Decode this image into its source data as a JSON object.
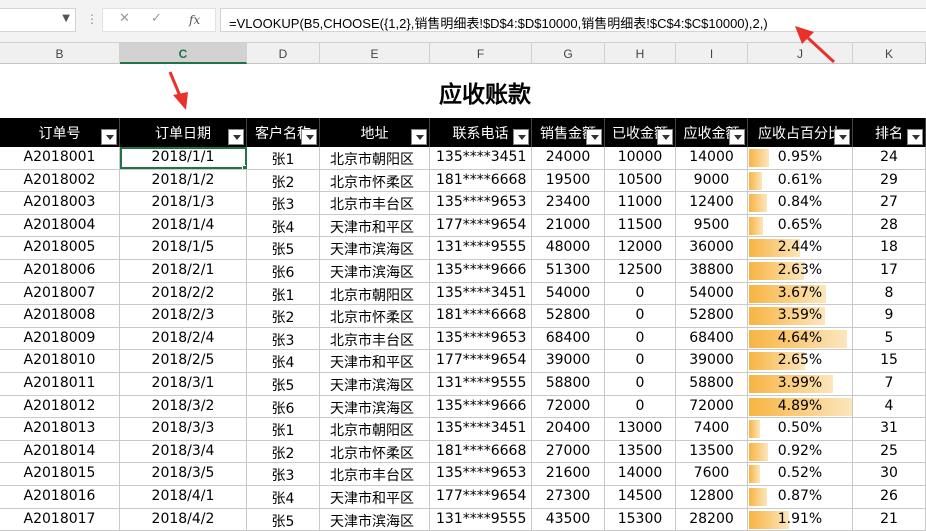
{
  "formula_bar": {
    "cancel_icon": "✕",
    "enter_icon": "✓",
    "fx_label": "fx",
    "formula": "=VLOOKUP(B5,CHOOSE({1,2},销售明细表!$D$4:$D$10000,销售明细表!$C$4:$C$10000),2,)"
  },
  "columns": [
    "B",
    "C",
    "D",
    "E",
    "F",
    "G",
    "H",
    "I",
    "J",
    "K"
  ],
  "selected_column": "C",
  "title": "应收账款",
  "headers": [
    "订单号",
    "订单日期",
    "客户名称",
    "地址",
    "联系电话",
    "销售金额",
    "已收金额",
    "应收金额",
    "应收占百分比",
    "排名"
  ],
  "rows": [
    [
      "A2018001",
      "2018/1/1",
      "张1",
      "北京市朝阳区",
      "135****3451",
      "24000",
      "10000",
      "14000",
      "0.95%",
      "24"
    ],
    [
      "A2018002",
      "2018/1/2",
      "张2",
      "北京市怀柔区",
      "181****6668",
      "19500",
      "10500",
      "9000",
      "0.61%",
      "29"
    ],
    [
      "A2018003",
      "2018/1/3",
      "张3",
      "北京市丰台区",
      "135****9653",
      "23400",
      "11000",
      "12400",
      "0.84%",
      "27"
    ],
    [
      "A2018004",
      "2018/1/4",
      "张4",
      "天津市和平区",
      "177****9654",
      "21000",
      "11500",
      "9500",
      "0.65%",
      "28"
    ],
    [
      "A2018005",
      "2018/1/5",
      "张5",
      "天津市滨海区",
      "131****9555",
      "48000",
      "12000",
      "36000",
      "2.44%",
      "18"
    ],
    [
      "A2018006",
      "2018/2/1",
      "张6",
      "天津市滨海区",
      "135****9666",
      "51300",
      "12500",
      "38800",
      "2.63%",
      "17"
    ],
    [
      "A2018007",
      "2018/2/2",
      "张1",
      "北京市朝阳区",
      "135****3451",
      "54000",
      "0",
      "54000",
      "3.67%",
      "8"
    ],
    [
      "A2018008",
      "2018/2/3",
      "张2",
      "北京市怀柔区",
      "181****6668",
      "52800",
      "0",
      "52800",
      "3.59%",
      "9"
    ],
    [
      "A2018009",
      "2018/2/4",
      "张3",
      "北京市丰台区",
      "135****9653",
      "68400",
      "0",
      "68400",
      "4.64%",
      "5"
    ],
    [
      "A2018010",
      "2018/2/5",
      "张4",
      "天津市和平区",
      "177****9654",
      "39000",
      "0",
      "39000",
      "2.65%",
      "15"
    ],
    [
      "A2018011",
      "2018/3/1",
      "张5",
      "天津市滨海区",
      "131****9555",
      "58800",
      "0",
      "58800",
      "3.99%",
      "7"
    ],
    [
      "A2018012",
      "2018/3/2",
      "张6",
      "天津市滨海区",
      "135****9666",
      "72000",
      "0",
      "72000",
      "4.89%",
      "4"
    ],
    [
      "A2018013",
      "2018/3/3",
      "张1",
      "北京市朝阳区",
      "135****3451",
      "20400",
      "13000",
      "7400",
      "0.50%",
      "31"
    ],
    [
      "A2018014",
      "2018/3/4",
      "张2",
      "北京市怀柔区",
      "181****6668",
      "27000",
      "13500",
      "13500",
      "0.92%",
      "25"
    ],
    [
      "A2018015",
      "2018/3/5",
      "张3",
      "北京市丰台区",
      "135****9653",
      "21600",
      "14000",
      "7600",
      "0.52%",
      "30"
    ],
    [
      "A2018016",
      "2018/4/1",
      "张4",
      "天津市和平区",
      "177****9654",
      "27300",
      "14500",
      "12800",
      "0.87%",
      "26"
    ],
    [
      "A2018017",
      "2018/4/2",
      "张5",
      "天津市滨海区",
      "131****9555",
      "43500",
      "15300",
      "28200",
      "1.91%",
      "21"
    ]
  ],
  "colors": {
    "accent": "#217346",
    "databar": "#f8b442",
    "annotation": "#e8312a"
  }
}
